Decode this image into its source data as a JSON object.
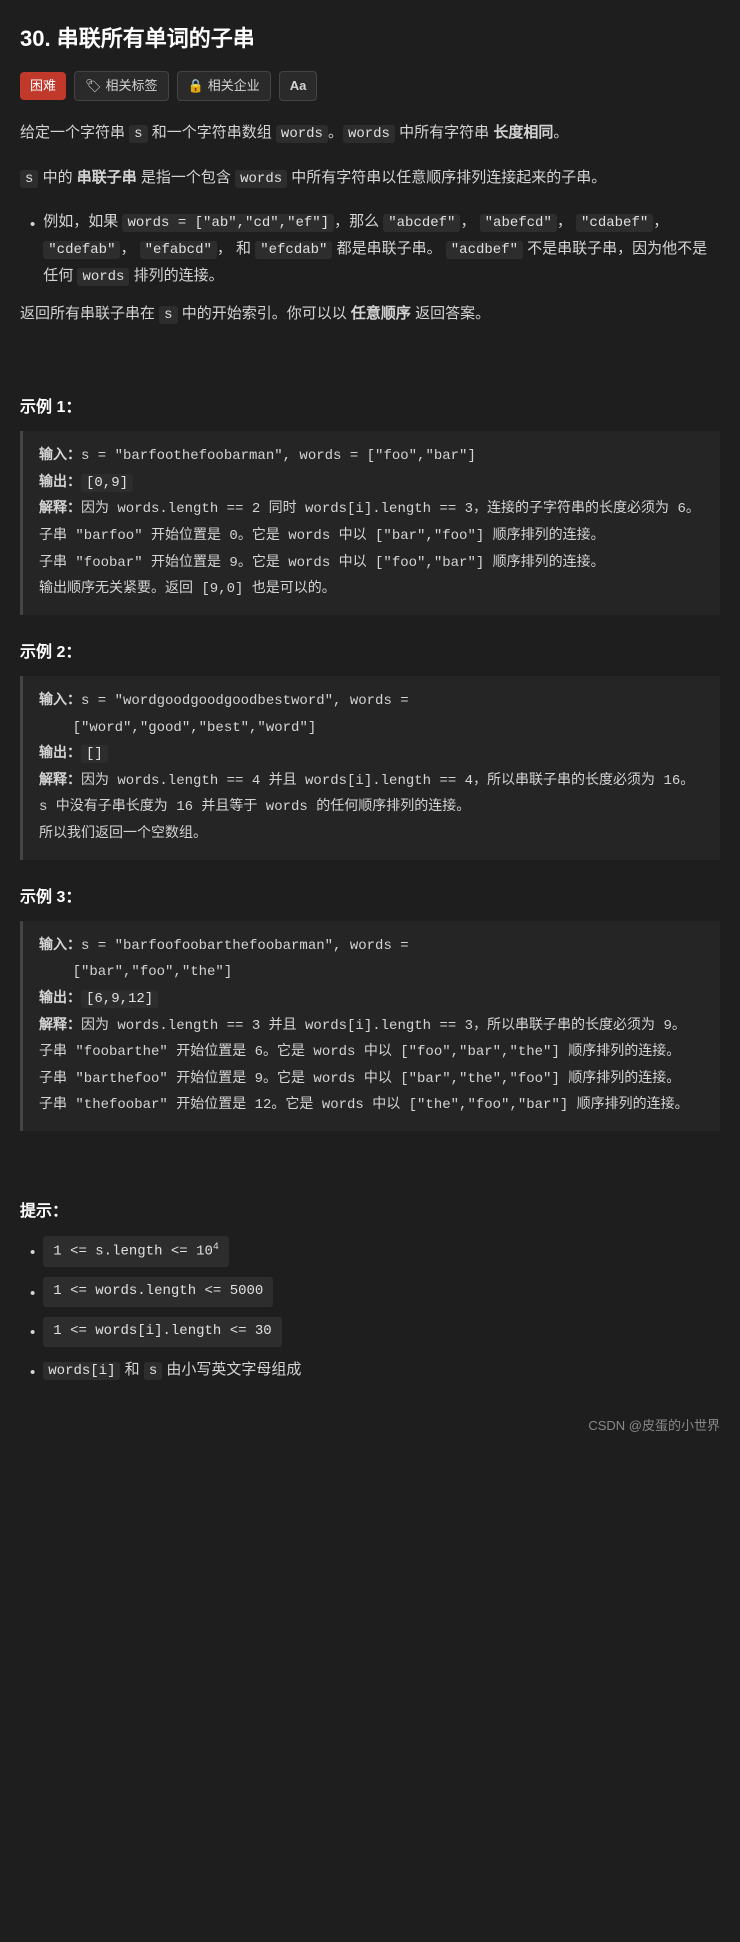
{
  "title": "30. 串联所有单词的子串",
  "tags": [
    {
      "label": "困难",
      "type": "hard"
    },
    {
      "label": "相关标签",
      "type": "related",
      "icon": "tag"
    },
    {
      "label": "相关企业",
      "type": "company",
      "icon": "lock"
    },
    {
      "label": "Aa",
      "type": "font"
    }
  ],
  "description": {
    "part1": "给定一个字符串 ",
    "s": "s",
    "part2": " 和一个字符串数组 ",
    "words": "words",
    "part3": "。",
    "words2": "words",
    "part4": " 中所有字符串 ",
    "bold1": "长度相同",
    "part5": "。",
    "p2_1": "s",
    "bold2": "串联子串",
    "words3": "words",
    "p2_desc": " 中所有字符串以任意顺序排列连接起来的子串。"
  },
  "example_desc": "例如，如果 words = [\"ab\",\"cd\",\"ef\"]，那么 \"abcdef\"，\"abefcd\"，\"cdabef\"，\"cdefab\"，\"efabcd\"，和 \"efcdab\" 都是串联子串。\"acdbef\" 不是串联子串，因为他不是任何 words 排列的连接。",
  "return_desc": "返回所有串联子串在 s 中的开始索引。你可以以",
  "bold_order": "任意顺序",
  "return_desc2": "返回答案。",
  "examples": [
    {
      "id": "示例 1：",
      "input": "s = \"barfoothefoobarman\", words = [\"foo\",\"bar\"]",
      "output": "[0,9]",
      "explanation": "因为 words.length == 2 同时 words[i].length == 3，连接的子字符串的长度必须为 6。\n子串 \"barfoo\" 开始位置是 0。它是 words 中以 [\"bar\",\"foo\"] 顺序排列的连接。\n子串 \"foobar\" 开始位置是 9。它是 words 中以 [\"foo\",\"bar\"] 顺序排列的连接。\n输出顺序无关紧要。返回 [9,0] 也是可以的。"
    },
    {
      "id": "示例 2：",
      "input": "s = \"wordgoodgoodgoodbestword\", words = [\"word\",\"good\",\"best\",\"word\"]",
      "output": "[]",
      "explanation": "因为 words.length == 4 并且 words[i].length == 4，所以串联子串的长度必须为 16。\ns 中没有子串长度为 16 并且等于 words 的任何顺序排列的连接。\n所以我们返回一个空数组。"
    },
    {
      "id": "示例 3：",
      "input": "s = \"barfoofoobarthefoobarman\", words = [\"bar\",\"foo\",\"the\"]",
      "output": "[6,9,12]",
      "explanation": "因为 words.length == 3 并且 words[i].length == 3，所以串联子串的长度必须为 9。\n子串 \"foobarthe\" 开始位置是 6。它是 words 中以 [\"foo\",\"bar\",\"the\"] 顺序排列的连接。\n子串 \"barthefoo\" 开始位置是 9。它是 words 中以 [\"bar\",\"the\",\"foo\"] 顺序排列的连接。\n子串 \"thefoobar\" 开始位置是 12。它是 words 中以 [\"the\",\"foo\",\"bar\"] 顺序排列的连接。"
    }
  ],
  "hints_title": "提示：",
  "hints": [
    {
      "code": "1 <= s.length <= 10",
      "sup": "4"
    },
    {
      "code": "1 <= words.length <= 5000"
    },
    {
      "code": "1 <= words[i].length <= 30"
    },
    {
      "text1": "words[i]",
      "text2": " 和 ",
      "text3": "s",
      "text4": " 由小写英文字母组成"
    }
  ],
  "footer": "CSDN @皮蛋的小世界"
}
